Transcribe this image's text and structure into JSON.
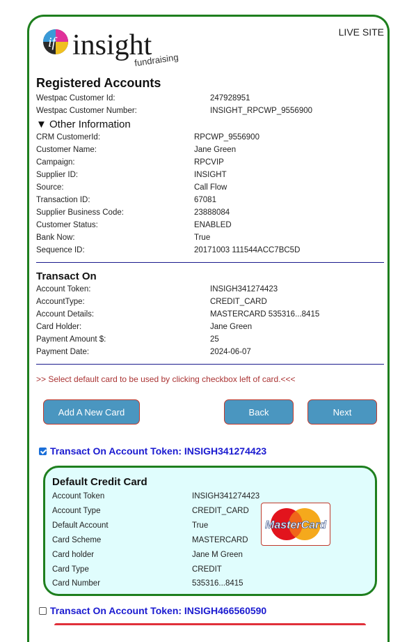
{
  "header": {
    "logo_text": "insight",
    "logo_sub": "fundraising",
    "logo_mark": "if",
    "live_site": "LIVE SITE"
  },
  "registered": {
    "title": "Registered Accounts",
    "rows": [
      {
        "label": "Westpac Customer Id:",
        "value": "247928951"
      },
      {
        "label": "Westpac Customer Number:",
        "value": "INSIGHT_RPCWP_9556900"
      }
    ]
  },
  "other_info": {
    "toggle": "▼ Other Information",
    "rows": [
      {
        "label": "CRM CustomerId:",
        "value": "RPCWP_9556900"
      },
      {
        "label": "Customer Name:",
        "value": "Jane Green"
      },
      {
        "label": "Campaign:",
        "value": "RPCVIP"
      },
      {
        "label": "Supplier ID:",
        "value": "INSIGHT"
      },
      {
        "label": "Source:",
        "value": "Call Flow"
      },
      {
        "label": "Transaction ID:",
        "value": "67081"
      },
      {
        "label": "Supplier Business Code:",
        "value": "23888084"
      },
      {
        "label": "Customer Status:",
        "value": "ENABLED"
      },
      {
        "label": "Bank Now:",
        "value": "True"
      },
      {
        "label": "Sequence ID:",
        "value": "20171003 111544ACC7BC5D"
      }
    ]
  },
  "transact": {
    "title": "Transact On",
    "rows": [
      {
        "label": "Account Token:",
        "value": "INSIGH341274423"
      },
      {
        "label": "AccountType:",
        "value": "CREDIT_CARD"
      },
      {
        "label": "Account Details:",
        "value": "MASTERCARD 535316...8415"
      },
      {
        "label": "Card Holder:",
        "value": "Jane Green"
      },
      {
        "label": "Payment Amount $:",
        "value": "25"
      },
      {
        "label": "Payment Date:",
        "value": "2024-06-07"
      }
    ]
  },
  "note": ">> Select default card to be used by clicking checkbox left of card.<<<",
  "buttons": {
    "add": "Add A New Card",
    "back": "Back",
    "next": "Next"
  },
  "tokens": [
    {
      "label": "Transact On Account Token: INSIGH341274423",
      "checked": true
    },
    {
      "label": "Transact On Account Token: INSIGH466560590",
      "checked": false
    }
  ],
  "default_card": {
    "title": "Default Credit Card",
    "rows": [
      {
        "label": "Account Token",
        "value": "INSIGH341274423"
      },
      {
        "label": "Account Type",
        "value": "CREDIT_CARD"
      },
      {
        "label": "Default Account",
        "value": "True"
      },
      {
        "label": "Card Scheme",
        "value": "MASTERCARD"
      },
      {
        "label": "Card holder",
        "value": "Jane M Green"
      },
      {
        "label": "Card Type",
        "value": "CREDIT"
      },
      {
        "label": "Card Number",
        "value": "535316...8415"
      }
    ],
    "brand_text": "MasterCard"
  },
  "colors": {
    "green_border": "#1e7f1e",
    "button_blue": "#4a96c0",
    "token_blue": "#1a1ad0",
    "card_bg": "#e0fdfd",
    "note_red": "#a33"
  }
}
